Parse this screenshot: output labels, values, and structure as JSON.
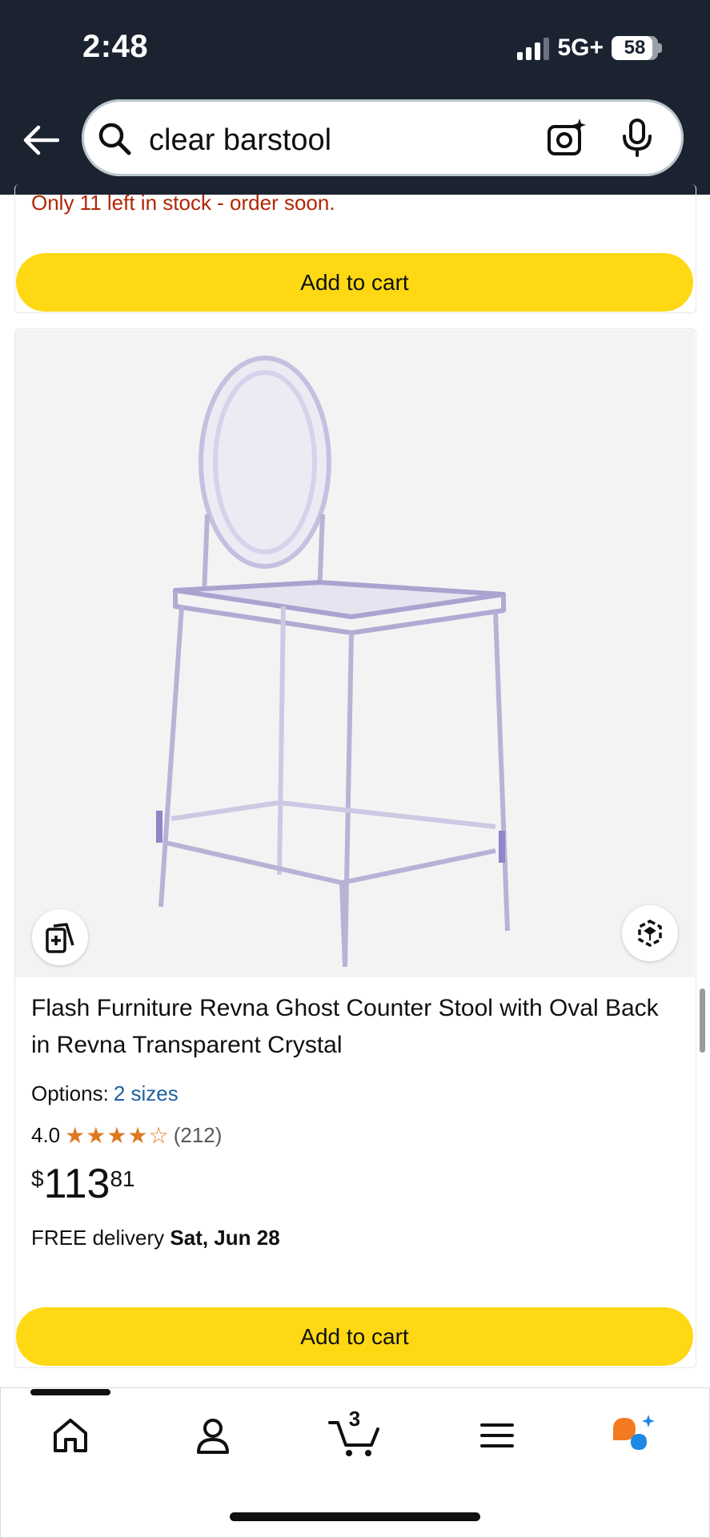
{
  "status_bar": {
    "time": "2:48",
    "network": "5G+",
    "battery": "58"
  },
  "search": {
    "query": "clear barstool"
  },
  "previous_item": {
    "stock_notice": "Only 11 left in stock - order soon.",
    "add_to_cart_label": "Add to cart"
  },
  "product": {
    "title": "Flash Furniture Revna Ghost Counter Stool with Oval Back in Revna Transparent Crystal",
    "options_label": "Options:",
    "options_link": "2 sizes",
    "rating_value": "4.0",
    "rating_stars": 4,
    "rating_count": "(212)",
    "price_symbol": "$",
    "price_whole": "113",
    "price_fraction": "81",
    "delivery_prefix": "FREE delivery",
    "delivery_date": "Sat, Jun 28",
    "add_to_cart_label": "Add to cart"
  },
  "bottom_nav": {
    "cart_count": "3"
  },
  "colors": {
    "header_bg": "#1b2230",
    "cart_button": "#ffd814",
    "link": "#2162a1",
    "star": "#de7921",
    "stock_warning": "#b12704"
  }
}
